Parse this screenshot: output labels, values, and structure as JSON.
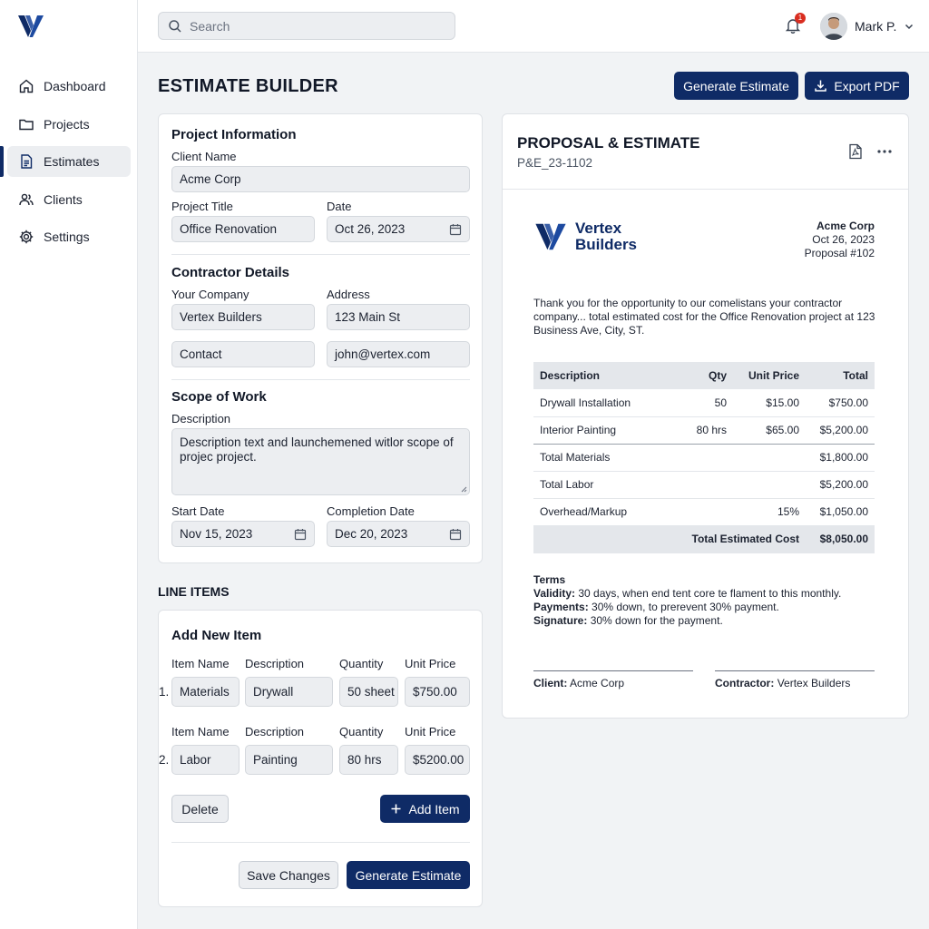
{
  "nav": {
    "items": [
      {
        "label": "Dashboard",
        "icon": "home-icon"
      },
      {
        "label": "Projects",
        "icon": "folder-icon"
      },
      {
        "label": "Estimates",
        "icon": "document-icon",
        "active": true
      },
      {
        "label": "Clients",
        "icon": "users-icon"
      },
      {
        "label": "Settings",
        "icon": "gear-icon"
      }
    ]
  },
  "topbar": {
    "search_placeholder": "Search",
    "notification_count": "1",
    "user_name": "Mark P."
  },
  "page": {
    "title": "ESTIMATE BUILDER",
    "generate_label": "Generate Estimate",
    "export_label": "Export PDF"
  },
  "project": {
    "section_title": "Project Information",
    "client_name_label": "Client Name",
    "client_name": "Acme Corp",
    "project_title_label": "Project Title",
    "project_title": "Office Renovation",
    "date_label": "Date",
    "date": "Oct 26, 2023"
  },
  "contractor": {
    "section_title": "Contractor Details",
    "company_label": "Your Company",
    "company": "Vertex Builders",
    "address_label": "Address",
    "address": "123 Main St",
    "contact": "Contact",
    "email": "john@vertex.com"
  },
  "scope": {
    "section_title": "Scope of Work",
    "description_label": "Description",
    "description": "Description text and launchemened witlor scope of projec project.",
    "start_label": "Start Date",
    "start": "Nov 15, 2023",
    "completion_label": "Completion Date",
    "completion": "Dec 20, 2023"
  },
  "line_items": {
    "section_title": "LINE ITEMS",
    "card_title": "Add New Item",
    "headers": {
      "name": "Item Name",
      "description": "Description",
      "quantity": "Quantity",
      "unit_price": "Unit Price"
    },
    "rows": [
      {
        "num": "1.",
        "name": "Materials",
        "description": "Drywall",
        "quantity": "50 sheet",
        "unit_price": "$750.00"
      },
      {
        "num": "2.",
        "name": "Labor",
        "description": "Painting",
        "quantity": "80 hrs",
        "unit_price": "$5200.00"
      }
    ],
    "delete_label": "Delete",
    "add_label": "Add Item",
    "save_label": "Save Changes",
    "generate_label": "Generate Estimate"
  },
  "proposal": {
    "title": "PROPOSAL & ESTIMATE",
    "number": "P&E_23-1102",
    "brand_line1": "Vertex",
    "brand_line2": "Builders",
    "client": "Acme Corp",
    "date": "Oct 26, 2023",
    "proposal_no": "Proposal #102",
    "intro": "Thank you for the opportunity to our comelistans your contractor company... total estimated cost for the Office Renovation project at 123 Business Ave, City, ST.",
    "table": {
      "headers": {
        "description": "Description",
        "qty": "Qty",
        "unit_price": "Unit Price",
        "total": "Total"
      },
      "rows": [
        {
          "description": "Drywall Installation",
          "qty": "50",
          "unit_price": "$15.00",
          "total": "$750.00"
        },
        {
          "description": "Interior Painting",
          "qty": "80 hrs",
          "unit_price": "$65.00",
          "total": "$5,200.00"
        },
        {
          "description": "Total Materials",
          "qty": "",
          "unit_price": "",
          "total": "$1,800.00"
        },
        {
          "description": "Total Labor",
          "qty": "",
          "unit_price": "",
          "total": "$5,200.00"
        },
        {
          "description": "Overhead/Markup",
          "qty": "",
          "unit_price": "15%",
          "total": "$1,050.00"
        }
      ],
      "total_label": "Total Estimated Cost",
      "total_value": "$8,050.00"
    },
    "terms": {
      "heading": "Terms",
      "validity_label": "Validity:",
      "validity": "30 days, when end tent core te flament to this monthly.",
      "payments_label": "Payments:",
      "payments": "30% down, to prerevent 30% payment.",
      "signature_label": "Signature:",
      "signature": "30% down for the payment."
    },
    "sign": {
      "client_label": "Client:",
      "client": "Acme Corp",
      "contractor_label": "Contractor:",
      "contractor": "Vertex Builders"
    }
  },
  "colors": {
    "primary": "#0f2b66",
    "badge": "#d92d20",
    "surface": "#eceef1"
  }
}
